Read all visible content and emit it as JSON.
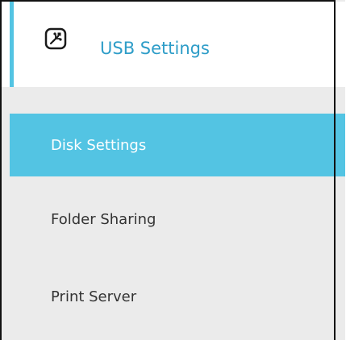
{
  "header": {
    "title": "USB Settings",
    "icon": "usb-icon",
    "accent_color": "#53c4e3",
    "title_color": "#2e9dc8"
  },
  "menu": {
    "items": [
      {
        "label": "Disk Settings",
        "active": true
      },
      {
        "label": "Folder Sharing",
        "active": false
      },
      {
        "label": "Print Server",
        "active": false
      }
    ],
    "active_bg_color": "#53c4e3"
  }
}
